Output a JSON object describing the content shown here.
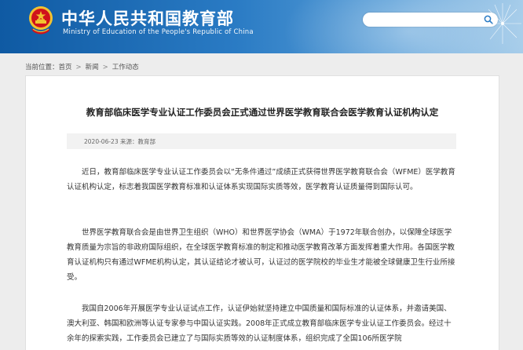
{
  "header": {
    "title": "中华人民共和国教育部",
    "subtitle": "Ministry of Education of the People's Republic of China",
    "search_placeholder": ""
  },
  "breadcrumb": {
    "label": "当前位置：",
    "items": [
      "首页",
      "新闻",
      "工作动态"
    ]
  },
  "article": {
    "title": "教育部临床医学专业认证工作委员会正式通过世界医学教育联合会医学教育认证机构认定",
    "meta": "2020-06-23  来源：教育部",
    "paragraphs": [
      "近日，教育部临床医学专业认证工作委员会以“无条件通过”成绩正式获得世界医学教育联合会（WFME）医学教育认证机构认定，标志着我国医学教育标准和认证体系实现国际实质等效，医学教育认证质量得到国际认可。",
      "世界医学教育联合会是由世界卫生组织（WHO）和世界医学协会（WMA）于1972年联合创办，以保障全球医学教育质量为宗旨的非政府国际组织，在全球医学教育标准的制定和推动医学教育改革方面发挥着重大作用。各国医学教育认证机构只有通过WFME机构认定，其认证结论才被认可，认证过的医学院校的毕业生才能被全球健康卫生行业所接受。",
      "我国自2006年开展医学专业认证试点工作，认证伊始就坚持建立中国质量和国际标准的认证体系，并邀请美国、澳大利亚、韩国和欧洲等认证专家参与中国认证实践。2008年正式成立教育部临床医学专业认证工作委员会。经过十余年的探索实践，工作委员会已建立了与国际实质等效的认证制度体系，组织完成了全国106所医学院"
    ]
  },
  "colors": {
    "header_start": "#0f5aa3",
    "header_end": "#a7cdea",
    "emblem_red": "#d0121b",
    "emblem_gold": "#f2c230"
  },
  "icons": {
    "emblem": "national-emblem-icon",
    "search": "search-icon",
    "decoration": "dandelion-icon"
  }
}
